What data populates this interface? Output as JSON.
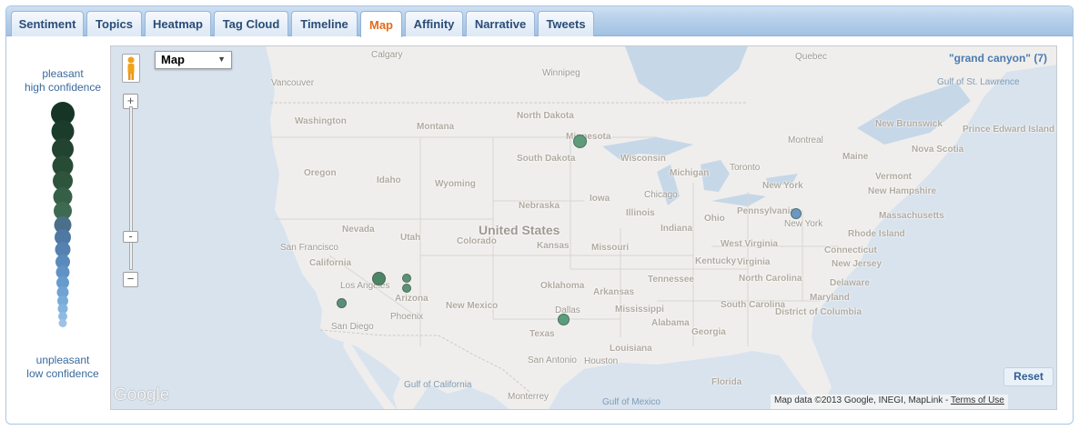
{
  "tabs": [
    {
      "label": "Sentiment",
      "active": false
    },
    {
      "label": "Topics",
      "active": false
    },
    {
      "label": "Heatmap",
      "active": false
    },
    {
      "label": "Tag Cloud",
      "active": false
    },
    {
      "label": "Timeline",
      "active": false
    },
    {
      "label": "Map",
      "active": true
    },
    {
      "label": "Affinity",
      "active": false
    },
    {
      "label": "Narrative",
      "active": false
    },
    {
      "label": "Tweets",
      "active": false
    }
  ],
  "legend": {
    "top_line1": "pleasant",
    "top_line2": "high confidence",
    "bottom_line1": "unpleasant",
    "bottom_line2": "low confidence",
    "scale": [
      {
        "color": "#163526"
      },
      {
        "color": "#1b3c2b"
      },
      {
        "color": "#21432f"
      },
      {
        "color": "#274b35"
      },
      {
        "color": "#2e543c"
      },
      {
        "color": "#365f47"
      },
      {
        "color": "#3f6a52"
      },
      {
        "color": "#4a6f8a"
      },
      {
        "color": "#4f78a2"
      },
      {
        "color": "#5481b0"
      },
      {
        "color": "#5a8abb"
      },
      {
        "color": "#6093c5"
      },
      {
        "color": "#679bcc"
      },
      {
        "color": "#6fa3d3"
      },
      {
        "color": "#79abd8"
      },
      {
        "color": "#84b3dd"
      },
      {
        "color": "#90bae2"
      },
      {
        "color": "#9dc2e6"
      }
    ]
  },
  "map": {
    "map_type": "Map",
    "query": "\"grand canyon\" (7)",
    "reset_label": "Reset",
    "logo_text": "Google",
    "attribution": "Map data ©2013 Google, INEGI, MapLink - ",
    "terms_label": "Terms of Use",
    "zoom_in": "+",
    "zoom_out": "−",
    "labels": [
      {
        "text": "Calgary",
        "kind": "city"
      },
      {
        "text": "Winnipeg",
        "kind": "city"
      },
      {
        "text": "Quebec",
        "kind": "city"
      },
      {
        "text": "Vancouver",
        "kind": "city"
      },
      {
        "text": "Washington",
        "kind": "state"
      },
      {
        "text": "Montana",
        "kind": "state"
      },
      {
        "text": "North Dakota",
        "kind": "state"
      },
      {
        "text": "Minnesota",
        "kind": "state"
      },
      {
        "text": "Oregon",
        "kind": "state"
      },
      {
        "text": "Idaho",
        "kind": "state"
      },
      {
        "text": "Wyoming",
        "kind": "state"
      },
      {
        "text": "South Dakota",
        "kind": "state"
      },
      {
        "text": "Wisconsin",
        "kind": "state"
      },
      {
        "text": "Michigan",
        "kind": "state"
      },
      {
        "text": "Toronto",
        "kind": "city"
      },
      {
        "text": "Montreal",
        "kind": "city"
      },
      {
        "text": "New Brunswick",
        "kind": "state"
      },
      {
        "text": "Nova Scotia",
        "kind": "state"
      },
      {
        "text": "Prince Edward Island",
        "kind": "state"
      },
      {
        "text": "Gulf of St. Lawrence",
        "kind": "water"
      },
      {
        "text": "Maine",
        "kind": "state"
      },
      {
        "text": "Vermont",
        "kind": "state"
      },
      {
        "text": "New Hampshire",
        "kind": "state"
      },
      {
        "text": "Massachusetts",
        "kind": "state"
      },
      {
        "text": "Rhode Island",
        "kind": "state"
      },
      {
        "text": "Connecticut",
        "kind": "state"
      },
      {
        "text": "New Jersey",
        "kind": "state"
      },
      {
        "text": "Delaware",
        "kind": "state"
      },
      {
        "text": "Maryland",
        "kind": "state"
      },
      {
        "text": "District of Columbia",
        "kind": "state"
      },
      {
        "text": "New York",
        "kind": "state"
      },
      {
        "text": "New York",
        "kind": "city"
      },
      {
        "text": "Pennsylvania",
        "kind": "state"
      },
      {
        "text": "Ohio",
        "kind": "state"
      },
      {
        "text": "Chicago",
        "kind": "city"
      },
      {
        "text": "Iowa",
        "kind": "state"
      },
      {
        "text": "Nebraska",
        "kind": "state"
      },
      {
        "text": "Illinois",
        "kind": "state"
      },
      {
        "text": "Indiana",
        "kind": "state"
      },
      {
        "text": "United States",
        "kind": "country"
      },
      {
        "text": "Nevada",
        "kind": "state"
      },
      {
        "text": "Utah",
        "kind": "state"
      },
      {
        "text": "Colorado",
        "kind": "state"
      },
      {
        "text": "Kansas",
        "kind": "state"
      },
      {
        "text": "Missouri",
        "kind": "state"
      },
      {
        "text": "San Francisco",
        "kind": "city"
      },
      {
        "text": "California",
        "kind": "state"
      },
      {
        "text": "West Virginia",
        "kind": "state"
      },
      {
        "text": "Virginia",
        "kind": "state"
      },
      {
        "text": "Kentucky",
        "kind": "state"
      },
      {
        "text": "Los Angeles",
        "kind": "city"
      },
      {
        "text": "Arizona",
        "kind": "state"
      },
      {
        "text": "Phoenix",
        "kind": "city"
      },
      {
        "text": "San Diego",
        "kind": "city"
      },
      {
        "text": "New Mexico",
        "kind": "state"
      },
      {
        "text": "Oklahoma",
        "kind": "state"
      },
      {
        "text": "Arkansas",
        "kind": "state"
      },
      {
        "text": "Tennessee",
        "kind": "state"
      },
      {
        "text": "North Carolina",
        "kind": "state"
      },
      {
        "text": "South Carolina",
        "kind": "state"
      },
      {
        "text": "Mississippi",
        "kind": "state"
      },
      {
        "text": "Alabama",
        "kind": "state"
      },
      {
        "text": "Georgia",
        "kind": "state"
      },
      {
        "text": "Dallas",
        "kind": "city"
      },
      {
        "text": "Texas",
        "kind": "state"
      },
      {
        "text": "Louisiana",
        "kind": "state"
      },
      {
        "text": "San Antonio",
        "kind": "city"
      },
      {
        "text": "Houston",
        "kind": "city"
      },
      {
        "text": "Florida",
        "kind": "state"
      },
      {
        "text": "Gulf of California",
        "kind": "water"
      },
      {
        "text": "Monterrey",
        "kind": "city"
      },
      {
        "text": "Gulf of Mexico",
        "kind": "water"
      }
    ],
    "pins": [
      {
        "color": "#5c9c7c"
      },
      {
        "color": "#4d8466"
      },
      {
        "color": "#5b9275"
      },
      {
        "color": "#5b9275"
      },
      {
        "color": "#5b8f78"
      },
      {
        "color": "#5c9c7c"
      },
      {
        "color": "#6a98c0"
      }
    ]
  }
}
